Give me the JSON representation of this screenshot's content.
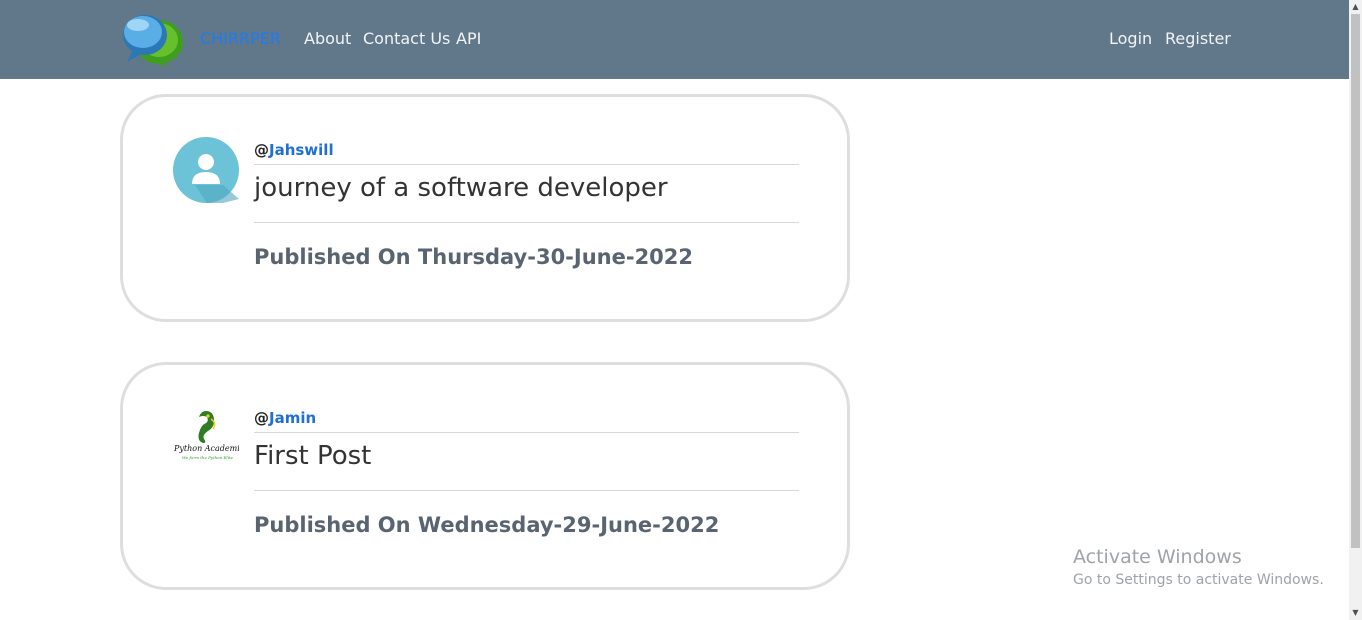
{
  "nav": {
    "brand": "CHIRRPER",
    "links": [
      "About",
      "Contact Us",
      "API"
    ],
    "auth": [
      "Login",
      "Register"
    ]
  },
  "posts": [
    {
      "at": "@",
      "username": "Jahswill",
      "title": "journey of a software developer",
      "published": "Published On Thursday-30-June-2022",
      "avatar": "default-user-icon"
    },
    {
      "at": "@",
      "username": "Jamin",
      "title": "First Post",
      "published": "Published On Wednesday-29-June-2022",
      "avatar": "python-academia-logo",
      "avatar_text": "Python Academia",
      "avatar_subtext": "We form the Python Elite"
    }
  ],
  "watermark": {
    "title": "Activate Windows",
    "subtitle": "Go to Settings to activate Windows."
  },
  "colors": {
    "navbar": "#60788a",
    "brand": "#1e7bf0",
    "username_link": "#1f6fd6"
  }
}
